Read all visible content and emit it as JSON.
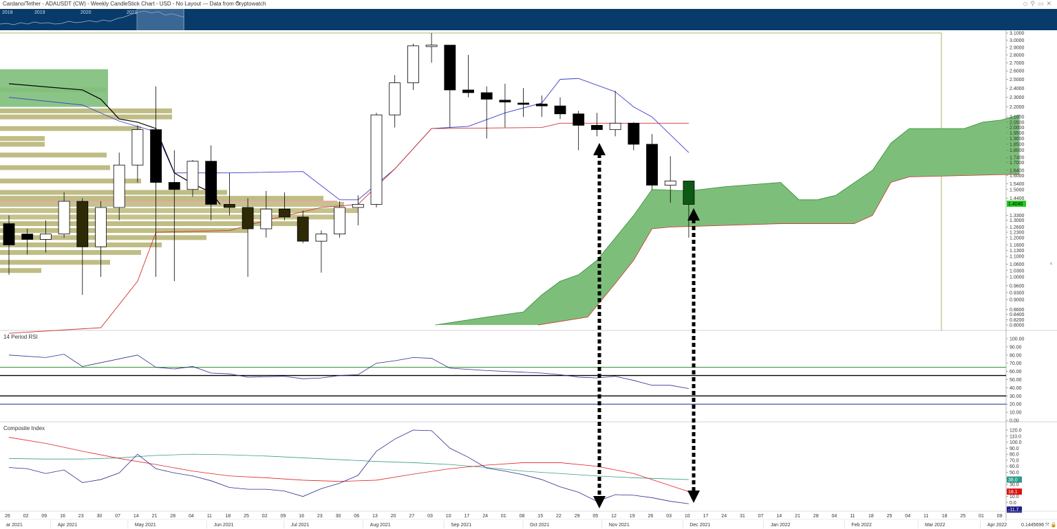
{
  "window": {
    "title": "Cardano/Tether - ADAUSDT (CW) - Weekly CandleStick Chart - USD - No Layout --- Data from Cryptowatch",
    "pencil_icon": "pencil-icon",
    "zoom_readout": "0.1445696"
  },
  "navigator": {
    "years": [
      "2018",
      "2019",
      "2020",
      "2021"
    ]
  },
  "panes": {
    "rsi_title": "14 Period RSI",
    "composite_title": "Composite Index"
  },
  "colors": {
    "up_candle": "#ffffff",
    "down_candle": "#000000",
    "cloud": "#7dbf7a",
    "cloud_edge": "#2f8a35",
    "volume_profile": "#bcb97e",
    "volume_profile_dark": "#2d2a05",
    "tenkan": "#3a3acc",
    "kijun": "#d03030",
    "poc_line": "#cc2222",
    "price_badge": "#22cc22",
    "navigator_bg": "#083a6a"
  },
  "chart_data": [
    {
      "type": "candlestick",
      "title": "Cardano/Tether - ADAUSDT (CW) - Weekly CandleStick Chart",
      "y_ticks": [
        "3.1000",
        "3.0000",
        "2.9000",
        "2.8000",
        "2.7000",
        "2.6000",
        "2.5000",
        "2.4000",
        "2.3000",
        "2.2000",
        "2.1000",
        "2.0500",
        "2.0000",
        "1.9500",
        "1.9000",
        "1.8500",
        "1.8000",
        "1.7400",
        "1.7000",
        "1.6400",
        "1.6000",
        "1.5400",
        "1.5000",
        "1.4400",
        "1.3300",
        "1.3000",
        "1.2600",
        "1.2300",
        "1.2000",
        "1.1600",
        "1.1300",
        "1.1000",
        "1.0600",
        "1.0300",
        "1.0000",
        "0.9600",
        "0.9300",
        "0.9000",
        "0.8600",
        "0.8400",
        "0.8200",
        "0.8000"
      ],
      "last_price": "1.4040",
      "candles": [
        {
          "x": "26",
          "o": 1.28,
          "h": 1.33,
          "l": 1.01,
          "c": 1.16
        },
        {
          "x": "02",
          "o": 1.22,
          "h": 1.25,
          "l": 1.11,
          "c": 1.19
        },
        {
          "x": "09",
          "o": 1.19,
          "h": 1.3,
          "l": 1.12,
          "c": 1.22
        },
        {
          "x": "16",
          "o": 1.22,
          "h": 1.48,
          "l": 1.2,
          "c": 1.42
        },
        {
          "x": "23",
          "o": 1.42,
          "h": 1.44,
          "l": 0.92,
          "c": 1.15
        },
        {
          "x": "30",
          "o": 1.15,
          "h": 1.42,
          "l": 1.0,
          "c": 1.38
        },
        {
          "x": "07",
          "o": 1.38,
          "h": 1.78,
          "l": 1.3,
          "c": 1.68
        },
        {
          "x": "14",
          "o": 1.68,
          "h": 2.02,
          "l": 1.55,
          "c": 1.98
        },
        {
          "x": "21",
          "o": 1.98,
          "h": 2.42,
          "l": 1.0,
          "c": 1.55
        },
        {
          "x": "28",
          "o": 1.55,
          "h": 1.8,
          "l": 0.98,
          "c": 1.5
        },
        {
          "x": "04",
          "o": 1.5,
          "h": 1.72,
          "l": 1.45,
          "c": 1.71
        },
        {
          "x": "11",
          "o": 1.71,
          "h": 1.84,
          "l": 1.3,
          "c": 1.4
        },
        {
          "x": "18",
          "o": 1.4,
          "h": 1.62,
          "l": 1.33,
          "c": 1.38
        },
        {
          "x": "25",
          "o": 1.38,
          "h": 1.44,
          "l": 1.0,
          "c": 1.25
        },
        {
          "x": "02",
          "o": 1.25,
          "h": 1.49,
          "l": 1.2,
          "c": 1.37
        },
        {
          "x": "09",
          "o": 1.37,
          "h": 1.48,
          "l": 1.3,
          "c": 1.32
        },
        {
          "x": "16",
          "o": 1.32,
          "h": 1.36,
          "l": 1.17,
          "c": 1.18
        },
        {
          "x": "23",
          "o": 1.18,
          "h": 1.24,
          "l": 1.02,
          "c": 1.22
        },
        {
          "x": "30",
          "o": 1.22,
          "h": 1.42,
          "l": 1.2,
          "c": 1.38
        },
        {
          "x": "06",
          "o": 1.38,
          "h": 1.46,
          "l": 1.27,
          "c": 1.4
        },
        {
          "x": "13",
          "o": 1.4,
          "h": 2.14,
          "l": 1.38,
          "c": 2.12
        },
        {
          "x": "20",
          "o": 2.12,
          "h": 2.55,
          "l": 2.0,
          "c": 2.46
        },
        {
          "x": "27",
          "o": 2.46,
          "h": 2.95,
          "l": 2.38,
          "c": 2.92
        },
        {
          "x": "03",
          "o": 2.91,
          "h": 3.1,
          "l": 2.7,
          "c": 2.93
        },
        {
          "x": "10",
          "o": 2.93,
          "h": 2.93,
          "l": 2.0,
          "c": 2.38
        },
        {
          "x": "17",
          "o": 2.38,
          "h": 2.8,
          "l": 2.3,
          "c": 2.35
        },
        {
          "x": "24",
          "o": 2.35,
          "h": 2.42,
          "l": 1.9,
          "c": 2.28
        },
        {
          "x": "01",
          "o": 2.27,
          "h": 2.45,
          "l": 2.0,
          "c": 2.25
        },
        {
          "x": "08",
          "o": 2.24,
          "h": 2.4,
          "l": 2.1,
          "c": 2.23
        },
        {
          "x": "15",
          "o": 2.23,
          "h": 2.32,
          "l": 2.1,
          "c": 2.21
        },
        {
          "x": "22",
          "o": 2.21,
          "h": 2.3,
          "l": 2.08,
          "c": 2.13
        },
        {
          "x": "29",
          "o": 2.13,
          "h": 2.16,
          "l": 1.8,
          "c": 2.02
        },
        {
          "x": "05",
          "o": 2.02,
          "h": 2.14,
          "l": 1.92,
          "c": 1.98
        },
        {
          "x": "12",
          "o": 1.98,
          "h": 2.37,
          "l": 1.92,
          "c": 2.04
        },
        {
          "x": "19",
          "o": 2.04,
          "h": 2.05,
          "l": 1.8,
          "c": 1.85
        },
        {
          "x": "26",
          "o": 1.85,
          "h": 1.94,
          "l": 1.5,
          "c": 1.53
        },
        {
          "x": "03",
          "o": 1.53,
          "h": 1.75,
          "l": 1.41,
          "c": 1.56
        },
        {
          "x": "10",
          "o": 1.56,
          "h": 1.56,
          "l": 1.2,
          "c": 1.4
        }
      ],
      "tenkan": [
        [
          0,
          2.3
        ],
        [
          4,
          2.22
        ],
        [
          6,
          2.06
        ],
        [
          8,
          1.96
        ],
        [
          9,
          1.62
        ],
        [
          12,
          1.62
        ],
        [
          16,
          1.63
        ],
        [
          18,
          1.43
        ],
        [
          19,
          1.43
        ],
        [
          21,
          1.65
        ],
        [
          23,
          1.99
        ],
        [
          25,
          2.01
        ],
        [
          27,
          2.14
        ],
        [
          29,
          2.24
        ],
        [
          30,
          2.5
        ],
        [
          31,
          2.51
        ],
        [
          33,
          2.36
        ],
        [
          34,
          2.2
        ],
        [
          35,
          2.1
        ],
        [
          37,
          1.78
        ]
      ],
      "kijun": [
        [
          0,
          0.77
        ],
        [
          5,
          0.79
        ],
        [
          7,
          0.98
        ],
        [
          8,
          1.23
        ],
        [
          12,
          1.24
        ],
        [
          14,
          1.3
        ],
        [
          17,
          1.38
        ],
        [
          19,
          1.4
        ],
        [
          21,
          1.65
        ],
        [
          23,
          1.99
        ],
        [
          29,
          2.0
        ],
        [
          30,
          2.04
        ],
        [
          37,
          2.04
        ]
      ],
      "cloud_top": [
        [
          23.2,
          0.8
        ],
        [
          26,
          0.83
        ],
        [
          28,
          0.85
        ],
        [
          29,
          0.92
        ],
        [
          30,
          0.98
        ],
        [
          31,
          1.01
        ],
        [
          32,
          1.08
        ],
        [
          34,
          1.33
        ],
        [
          35,
          1.5
        ],
        [
          37,
          1.49
        ],
        [
          39,
          1.52
        ],
        [
          42,
          1.55
        ],
        [
          43,
          1.43
        ],
        [
          44,
          1.43
        ],
        [
          45,
          1.46
        ],
        [
          47,
          1.64
        ],
        [
          48,
          1.86
        ],
        [
          49,
          1.99
        ],
        [
          52,
          1.99
        ],
        [
          53,
          2.05
        ],
        [
          54,
          2.07
        ],
        [
          55,
          2.12
        ]
      ],
      "cloud_bottom": [
        [
          28.8,
          0.8
        ],
        [
          31.5,
          0.83
        ],
        [
          33,
          0.97
        ],
        [
          34,
          1.08
        ],
        [
          35,
          1.25
        ],
        [
          36,
          1.26
        ],
        [
          42,
          1.28
        ],
        [
          46,
          1.28
        ],
        [
          47,
          1.33
        ],
        [
          48,
          1.55
        ],
        [
          49,
          1.59
        ],
        [
          55,
          1.61
        ]
      ],
      "poc_line": 1.42,
      "volume_profile": [
        {
          "p": 2.38,
          "w": 155,
          "dark": 0
        },
        {
          "p": 2.16,
          "w": 250,
          "dark": 0
        },
        {
          "p": 2.1,
          "w": 250,
          "dark": 0
        },
        {
          "p": 1.99,
          "w": 205,
          "dark": 0
        },
        {
          "p": 1.9,
          "w": 65,
          "dark": 0
        },
        {
          "p": 1.85,
          "w": 65,
          "dark": 0
        },
        {
          "p": 1.76,
          "w": 155,
          "dark": 0
        },
        {
          "p": 1.66,
          "w": 160,
          "dark": 0
        },
        {
          "p": 1.56,
          "w": 205,
          "dark": 0
        },
        {
          "p": 1.48,
          "w": 330,
          "dark": 0
        },
        {
          "p": 1.44,
          "w": 470,
          "dark": 0
        },
        {
          "p": 1.4,
          "w": 500,
          "dark": 1
        },
        {
          "p": 1.36,
          "w": 520,
          "dark": 1
        },
        {
          "p": 1.32,
          "w": 490,
          "dark": 1
        },
        {
          "p": 1.28,
          "w": 440,
          "dark": 0
        },
        {
          "p": 1.24,
          "w": 360,
          "dark": 0
        },
        {
          "p": 1.2,
          "w": 300,
          "dark": 0
        },
        {
          "p": 1.16,
          "w": 235,
          "dark": 0
        },
        {
          "p": 1.12,
          "w": 205,
          "dark": 0
        },
        {
          "p": 1.07,
          "w": 160,
          "dark": 0
        },
        {
          "p": 1.03,
          "w": 60,
          "dark": 0
        }
      ]
    },
    {
      "type": "line",
      "title": "14 Period RSI",
      "y_ticks": [
        "100.00",
        "90.00",
        "80.00",
        "70.00",
        "60.00",
        "50.00",
        "40.00",
        "30.00",
        "20.00",
        "10.00",
        "0.00"
      ],
      "levels": [
        {
          "v": 65,
          "color": "#2a8a2a"
        },
        {
          "v": 55,
          "color": "#000000"
        },
        {
          "v": 30,
          "color": "#000000"
        },
        {
          "v": 20,
          "color": "#1a2a9a"
        }
      ],
      "rsi": [
        [
          0,
          80
        ],
        [
          2,
          77
        ],
        [
          3,
          81
        ],
        [
          4,
          66
        ],
        [
          7,
          80
        ],
        [
          8,
          65
        ],
        [
          9,
          63
        ],
        [
          10,
          66
        ],
        [
          11,
          58
        ],
        [
          12,
          57
        ],
        [
          13,
          53
        ],
        [
          15,
          54
        ],
        [
          16,
          51
        ],
        [
          17,
          52
        ],
        [
          18,
          55
        ],
        [
          19,
          56
        ],
        [
          20,
          70
        ],
        [
          21,
          73
        ],
        [
          22,
          77
        ],
        [
          23,
          76
        ],
        [
          24,
          64
        ],
        [
          26,
          61
        ],
        [
          28,
          59
        ],
        [
          29,
          58
        ],
        [
          30,
          56
        ],
        [
          31,
          53
        ],
        [
          32,
          52
        ],
        [
          33,
          54
        ],
        [
          34,
          49
        ],
        [
          35,
          43
        ],
        [
          36,
          43
        ],
        [
          37,
          39
        ]
      ]
    },
    {
      "type": "line",
      "title": "Composite Index",
      "y_ticks": [
        "120.0",
        "110.0",
        "100.0",
        "90.0",
        "80.0",
        "70.0",
        "60.0",
        "50.0",
        "40.0",
        "30.0",
        "20.0",
        "10.0",
        "0.0"
      ],
      "badges": [
        {
          "label": "38.0",
          "v": 38,
          "color": "#2a9a8a"
        },
        {
          "label": "18.1",
          "v": 18.1,
          "color": "#dd1111"
        },
        {
          "label": "-11.7",
          "v": -11.7,
          "color": "#1a1a8a"
        }
      ],
      "composite": [
        [
          0,
          58
        ],
        [
          1,
          56
        ],
        [
          2,
          48
        ],
        [
          3,
          54
        ],
        [
          4,
          33
        ],
        [
          5,
          38
        ],
        [
          6,
          49
        ],
        [
          7,
          80
        ],
        [
          8,
          56
        ],
        [
          9,
          49
        ],
        [
          10,
          44
        ],
        [
          11,
          36
        ],
        [
          12,
          25
        ],
        [
          13,
          22
        ],
        [
          14,
          22
        ],
        [
          15,
          19
        ],
        [
          16,
          10
        ],
        [
          17,
          23
        ],
        [
          18,
          32
        ],
        [
          19,
          45
        ],
        [
          20,
          85
        ],
        [
          21,
          105
        ],
        [
          22,
          120
        ],
        [
          23,
          119
        ],
        [
          24,
          90
        ],
        [
          25,
          75
        ],
        [
          26,
          57
        ],
        [
          27,
          52
        ],
        [
          28,
          46
        ],
        [
          29,
          38
        ],
        [
          30,
          26
        ],
        [
          31,
          17
        ],
        [
          32,
          2
        ],
        [
          33,
          13
        ],
        [
          34,
          12
        ],
        [
          35,
          8
        ],
        [
          36,
          2
        ],
        [
          37,
          -2
        ]
      ],
      "red": [
        [
          0,
          108
        ],
        [
          2,
          98
        ],
        [
          4,
          85
        ],
        [
          6,
          73
        ],
        [
          8,
          63
        ],
        [
          10,
          52
        ],
        [
          12,
          44
        ],
        [
          14,
          41
        ],
        [
          16,
          37
        ],
        [
          18,
          35
        ],
        [
          20,
          37
        ],
        [
          22,
          47
        ],
        [
          24,
          56
        ],
        [
          26,
          62
        ],
        [
          28,
          66
        ],
        [
          30,
          66
        ],
        [
          32,
          60
        ],
        [
          34,
          48
        ],
        [
          36,
          28
        ],
        [
          37,
          18
        ]
      ],
      "teal": [
        [
          0,
          73
        ],
        [
          2,
          72
        ],
        [
          4,
          72
        ],
        [
          6,
          74
        ],
        [
          8,
          78
        ],
        [
          10,
          80
        ],
        [
          12,
          79
        ],
        [
          14,
          77
        ],
        [
          16,
          74
        ],
        [
          18,
          71
        ],
        [
          20,
          68
        ],
        [
          22,
          66
        ],
        [
          24,
          63
        ],
        [
          26,
          58
        ],
        [
          28,
          52
        ],
        [
          30,
          48
        ],
        [
          32,
          44
        ],
        [
          34,
          41
        ],
        [
          36,
          39
        ],
        [
          37,
          38
        ]
      ]
    }
  ],
  "x_axis": {
    "weeks": [
      "26",
      "02",
      "09",
      "16",
      "23",
      "30",
      "07",
      "14",
      "21",
      "28",
      "04",
      "11",
      "18",
      "25",
      "02",
      "09",
      "16",
      "23",
      "30",
      "06",
      "13",
      "20",
      "27",
      "03",
      "10",
      "17",
      "24",
      "01",
      "08",
      "15",
      "22",
      "29",
      "05",
      "12",
      "19",
      "26",
      "03",
      "10",
      "17",
      "24",
      "31",
      "07",
      "14",
      "21",
      "28",
      "04",
      "11",
      "18",
      "25",
      "04",
      "11",
      "18",
      "25",
      "01",
      "08"
    ],
    "months": [
      {
        "label": "ar 2021",
        "i": 0
      },
      {
        "label": "Apr 2021",
        "i": 2.8
      },
      {
        "label": "May 2021",
        "i": 7
      },
      {
        "label": "Jun 2021",
        "i": 11.3
      },
      {
        "label": "Jul 2021",
        "i": 15.5
      },
      {
        "label": "Aug 2021",
        "i": 19.8
      },
      {
        "label": "Sep 2021",
        "i": 24.2
      },
      {
        "label": "Oct 2021",
        "i": 28.5
      },
      {
        "label": "Nov 2021",
        "i": 32.8
      },
      {
        "label": "Dec 2021",
        "i": 37.2
      },
      {
        "label": "Jan 2022",
        "i": 41.6
      },
      {
        "label": "Feb 2022",
        "i": 46
      },
      {
        "label": "Mar 2022",
        "i": 50
      },
      {
        "label": "Apr 2022",
        "i": 53.4
      }
    ]
  }
}
